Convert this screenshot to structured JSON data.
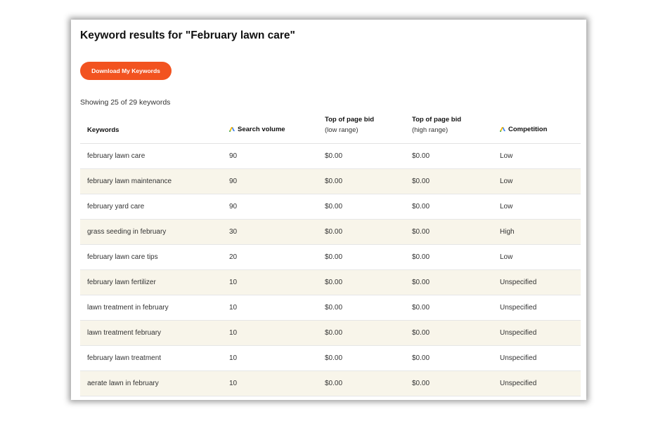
{
  "title": "Keyword results for \"February lawn care\"",
  "download_button": "Download My Keywords",
  "showing_text": "Showing 25 of 29 keywords",
  "colors": {
    "accent": "#f25320",
    "row_alt": "#f8f5ea",
    "ads_blue": "#4285f4",
    "ads_yellow": "#fbbc04",
    "ads_green": "#34a853"
  },
  "table": {
    "headers": {
      "keywords": "Keywords",
      "volume": "Search volume",
      "volume_icon": "google-ads-icon",
      "low_bid_line1": "Top of page bid",
      "low_bid_line2": "(low range)",
      "high_bid_line1": "Top of page bid",
      "high_bid_line2": "(high range)",
      "competition": "Competition",
      "competition_icon": "google-ads-icon"
    },
    "rows": [
      {
        "keyword": "february lawn care",
        "volume": "90",
        "low_bid": "$0.00",
        "high_bid": "$0.00",
        "competition": "Low"
      },
      {
        "keyword": "february lawn maintenance",
        "volume": "90",
        "low_bid": "$0.00",
        "high_bid": "$0.00",
        "competition": "Low"
      },
      {
        "keyword": "february yard care",
        "volume": "90",
        "low_bid": "$0.00",
        "high_bid": "$0.00",
        "competition": "Low"
      },
      {
        "keyword": "grass seeding in february",
        "volume": "30",
        "low_bid": "$0.00",
        "high_bid": "$0.00",
        "competition": "High"
      },
      {
        "keyword": "february lawn care tips",
        "volume": "20",
        "low_bid": "$0.00",
        "high_bid": "$0.00",
        "competition": "Low"
      },
      {
        "keyword": "february lawn fertilizer",
        "volume": "10",
        "low_bid": "$0.00",
        "high_bid": "$0.00",
        "competition": "Unspecified"
      },
      {
        "keyword": "lawn treatment in february",
        "volume": "10",
        "low_bid": "$0.00",
        "high_bid": "$0.00",
        "competition": "Unspecified"
      },
      {
        "keyword": "lawn treatment february",
        "volume": "10",
        "low_bid": "$0.00",
        "high_bid": "$0.00",
        "competition": "Unspecified"
      },
      {
        "keyword": "february lawn treatment",
        "volume": "10",
        "low_bid": "$0.00",
        "high_bid": "$0.00",
        "competition": "Unspecified"
      },
      {
        "keyword": "aerate lawn in february",
        "volume": "10",
        "low_bid": "$0.00",
        "high_bid": "$0.00",
        "competition": "Unspecified"
      }
    ]
  }
}
